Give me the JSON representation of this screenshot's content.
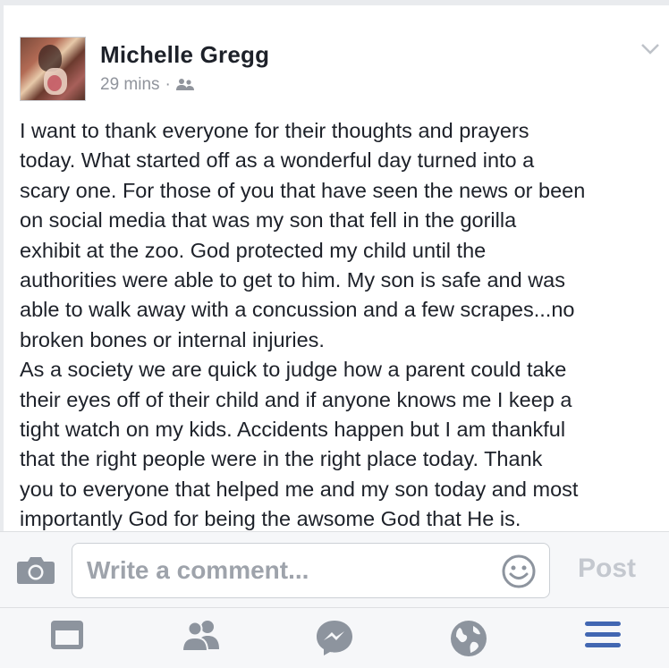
{
  "post": {
    "author": "Michelle Gregg",
    "time": "29 mins",
    "separator": "·",
    "audience_icon": "friends-icon",
    "body_lines": [
      "I want to thank everyone for their thoughts and prayers",
      "today. What started off as a wonderful day turned into a",
      "scary one. For those of you that have seen the news or been",
      "on social media that was my son that fell in the gorilla",
      "exhibit at the zoo. God protected my child until the",
      "authorities were able to get to him. My son is safe and was",
      "able to walk away with a concussion and a few scrapes...no",
      "broken bones or internal injuries.",
      "As a society we are quick to judge how a parent could take",
      "their eyes off of their child and if anyone knows me I keep a",
      "tight watch on my kids. Accidents happen but I am thankful",
      "that the right people were in the right place today. Thank",
      "you to everyone that helped me and my son today and most",
      "importantly God for being the awsome God that He is."
    ]
  },
  "comment_bar": {
    "placeholder": "Write a comment...",
    "post_label": "Post",
    "camera_icon": "camera-icon",
    "emoji_icon": "smiley-icon"
  },
  "tabbar": {
    "tabs": [
      {
        "icon": "news-feed-icon",
        "active": false
      },
      {
        "icon": "friend-requests-icon",
        "active": false
      },
      {
        "icon": "messenger-icon",
        "active": false
      },
      {
        "icon": "notifications-globe-icon",
        "active": false
      },
      {
        "icon": "menu-icon",
        "active": true
      }
    ]
  },
  "colors": {
    "text": "#1d2129",
    "muted": "#90949c",
    "icon_gray": "#8d949e",
    "active_blue": "#4267b2",
    "bar_bg": "#f6f7f9"
  }
}
